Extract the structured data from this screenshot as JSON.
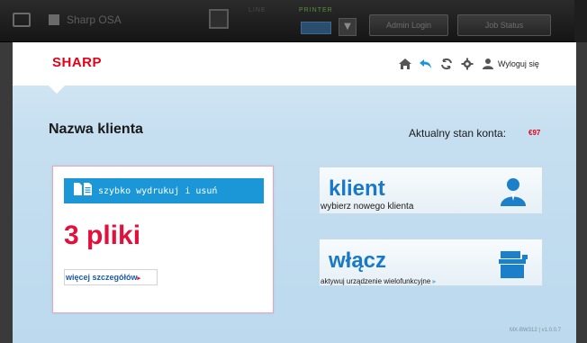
{
  "device_bar": {
    "app_title": "Sharp OSA",
    "line_led": "LINE",
    "printer_led": "PRINTER",
    "admin_login_label": "Admin Login",
    "job_status_label": "Job Status"
  },
  "header": {
    "logo": "SHARP",
    "logout_label": "Wyloguj się"
  },
  "main": {
    "client_label": "Nazwa klienta",
    "balance_label": "Aktualny stan konta:",
    "balance_value": "€97"
  },
  "quick_print": {
    "button_label": "szybko wydrukuj i usuń",
    "files_count": "3 pliki",
    "details_link": "więcej szczegółów",
    "details_arrow": "▸"
  },
  "tiles": [
    {
      "title": "klient",
      "subtitle": "wybierz nowego klienta",
      "icon": "user-icon"
    },
    {
      "title": "włącz",
      "subtitle": "aktywuj urządzenie wielofunkcyjne",
      "arrow": "▸",
      "icon": "printer-icon"
    }
  ],
  "footer": {
    "version": "MX-BW312 | v1.0.0.7"
  },
  "colors": {
    "brand_red": "#e2001a",
    "accent_blue": "#1b97d8",
    "title_blue": "#1978c8",
    "count_red": "#e2103a"
  }
}
